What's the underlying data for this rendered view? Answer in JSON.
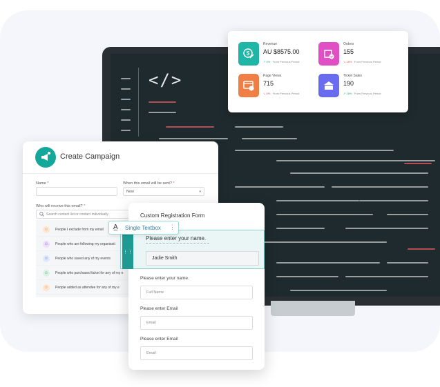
{
  "stats": {
    "revenue": {
      "label": "Revenue",
      "value": "AU $8575.00",
      "trend": "8%",
      "trend_text": "From Previous Period",
      "color": "#1fb5a7"
    },
    "orders": {
      "label": "Orders",
      "value": "155",
      "trend": "18%",
      "trend_text": "From Previous Period",
      "color": "#e14fc4"
    },
    "page_views": {
      "label": "Page Views",
      "value": "715",
      "trend": "8%",
      "trend_text": "From Previous Period",
      "color": "#f07f45"
    },
    "ticket_sales": {
      "label": "Ticket Sales",
      "value": "190",
      "trend": "18%",
      "trend_text": "From Previous Period",
      "color": "#6a6cf0"
    }
  },
  "campaign": {
    "title": "Create Campaign",
    "name_label": "Name",
    "name_value": "",
    "when_label": "When this email will be sent?",
    "when_value": "Now",
    "who_label": "Who will receive this email?",
    "search_placeholder": "Search contact list or contact individually",
    "recipients": [
      "People I exclude from my email",
      "People who are following my organisati",
      "People who saved any of my events",
      "People who purchased ticket for any of my e",
      "People added as attendee for any of my e"
    ]
  },
  "registration": {
    "title": "Custom Registration Form",
    "chip_label": "Single Textbox",
    "highlight_label": "Please enter your name.",
    "highlight_value": "Jadie Smith",
    "fields": [
      {
        "label": "Please enter your name.",
        "placeholder": "Full Name"
      },
      {
        "label": "Please enter Email",
        "placeholder": "Email"
      },
      {
        "label": "Please enter Email",
        "placeholder": "Email"
      }
    ]
  },
  "code_icon": "</>"
}
